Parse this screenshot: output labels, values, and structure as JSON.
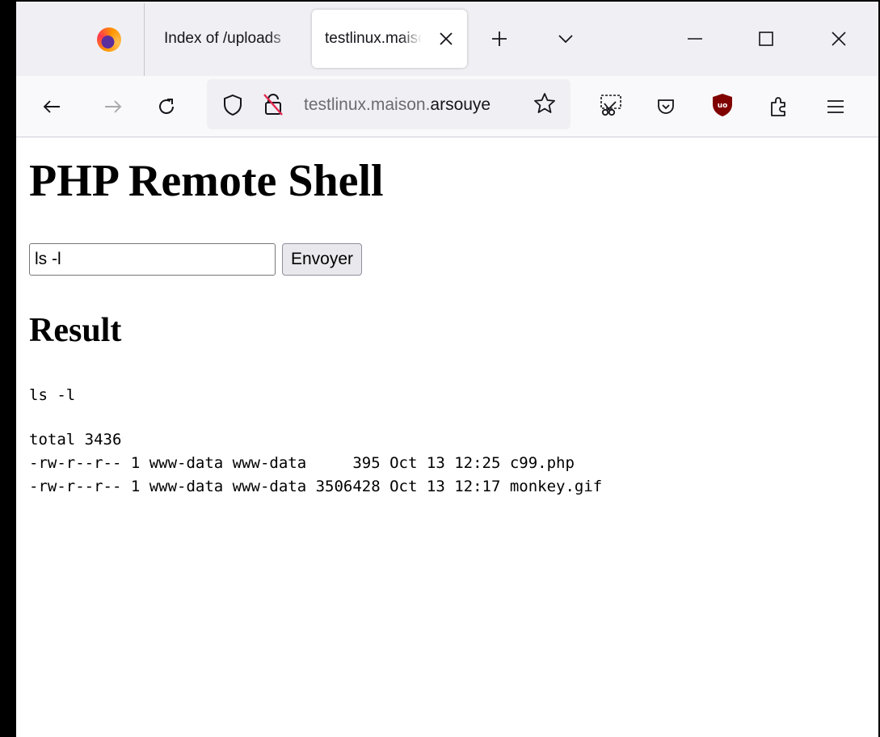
{
  "tabs": [
    {
      "label": "Index of /uploads"
    },
    {
      "label": "testlinux.maison.arsouye"
    }
  ],
  "toolbar": {
    "new_tab_label": "+"
  },
  "navbar": {
    "url_host": "testlinux.maison.",
    "url_domain": "arsouye"
  },
  "page": {
    "title": "PHP Remote Shell",
    "command_value": "ls -l",
    "submit_label": "Envoyer",
    "result_heading": "Result",
    "command_echo": "ls -l",
    "output_lines": [
      "total 3436",
      "-rw-r--r-- 1 www-data www-data     395 Oct 13 12:25 c99.php",
      "-rw-r--r-- 1 www-data www-data 3506428 Oct 13 12:17 monkey.gif"
    ]
  },
  "colors": {
    "tabstrip_bg": "#f0f0f4",
    "navbar_bg": "#f9f9fb",
    "urlbar_bg": "#f0f0f4",
    "ublock_red": "#800000"
  }
}
